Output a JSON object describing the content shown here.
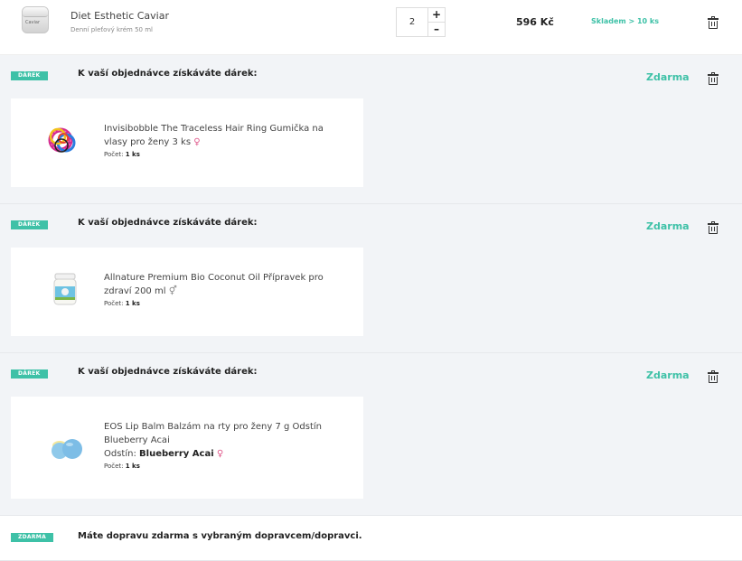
{
  "product": {
    "name": "Diet Esthetic Caviar",
    "subtitle": "Denní pleťový krém 50 ml",
    "jar_label": "Caviar",
    "quantity": "2",
    "plus": "+",
    "minus": "–",
    "price": "596 Kč",
    "stock": "Skladem > 10 ks",
    "icon": "product-jar"
  },
  "gifts": [
    {
      "badge": "DÁREK",
      "heading": "K vaší objednávce získáváte dárek:",
      "free_label": "Zdarma",
      "name": "Invisibobble The Traceless Hair Ring Gumička na vlasy pro ženy 3 ks",
      "gender_symbol": "♀",
      "count_label": "Počet:",
      "count_value": "1 ks",
      "variant_label": "",
      "variant_value": "",
      "icon": "hair-ring"
    },
    {
      "badge": "DÁREK",
      "heading": "K vaší objednávce získáváte dárek:",
      "free_label": "Zdarma",
      "name": "Allnature Premium Bio Coconut Oil Přípravek pro zdraví 200 ml",
      "gender_symbol": "⚥",
      "count_label": "Počet:",
      "count_value": "1 ks",
      "variant_label": "",
      "variant_value": "",
      "icon": "coconut-oil-jar"
    },
    {
      "badge": "DÁREK",
      "heading": "K vaší objednávce získáváte dárek:",
      "free_label": "Zdarma",
      "name": "EOS Lip Balm Balzám na rty pro ženy 7 g Odstín Blueberry Acai",
      "gender_symbol": "♀",
      "count_label": "Počet:",
      "count_value": "1 ks",
      "variant_label": "Odstín:",
      "variant_value": "Blueberry Acai",
      "icon": "lip-balm"
    }
  ],
  "shipping": {
    "badge": "ZDARMA",
    "text": "Máte dopravu zdarma s vybraným dopravcem/dopravci."
  },
  "colors": {
    "accent": "#3ec1a7",
    "section_bg": "#f2f4f7",
    "gender_pink": "#e05a8c"
  }
}
